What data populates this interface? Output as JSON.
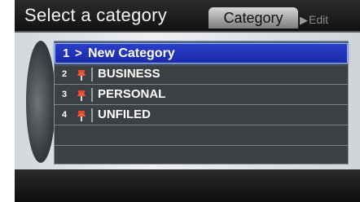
{
  "header": {
    "title": "Select a category",
    "tabs": [
      {
        "label": "Category",
        "active": true
      },
      {
        "label": "Edit",
        "active": false
      }
    ]
  },
  "list": {
    "items": [
      {
        "number": "1",
        "label": "New Category",
        "selected": true,
        "icon": "arrow-right-icon"
      },
      {
        "number": "2",
        "label": "BUSINESS",
        "selected": false,
        "icon": "pushpin-icon"
      },
      {
        "number": "3",
        "label": "PERSONAL",
        "selected": false,
        "icon": "pushpin-icon"
      },
      {
        "number": "4",
        "label": "UNFILED",
        "selected": false,
        "icon": "pushpin-icon"
      }
    ],
    "empty_rows": 2
  },
  "colors": {
    "selection": "#2236c0",
    "pin": "#e8462c",
    "list_background": "#3c3f43"
  }
}
